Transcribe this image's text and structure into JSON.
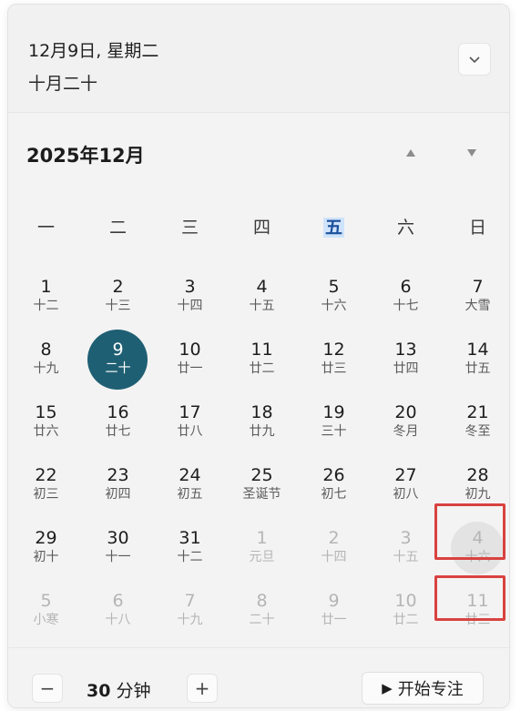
{
  "header": {
    "date_line": "12月9日, 星期二",
    "lunar_line": "十月二十",
    "collapse_icon": "chevron-down-icon"
  },
  "calendar": {
    "month_title": "2025年12月",
    "nav_up_icon": "triangle-up-icon",
    "nav_down_icon": "triangle-down-icon",
    "weekdays": [
      "一",
      "二",
      "三",
      "四",
      "五",
      "六",
      "日"
    ],
    "highlight_weekday_index": 4,
    "weeks": [
      [
        {
          "num": "1",
          "lunar": "十二"
        },
        {
          "num": "2",
          "lunar": "十三"
        },
        {
          "num": "3",
          "lunar": "十四"
        },
        {
          "num": "4",
          "lunar": "十五"
        },
        {
          "num": "5",
          "lunar": "十六"
        },
        {
          "num": "6",
          "lunar": "十七"
        },
        {
          "num": "7",
          "lunar": "大雪"
        }
      ],
      [
        {
          "num": "8",
          "lunar": "十九"
        },
        {
          "num": "9",
          "lunar": "二十",
          "selected": true
        },
        {
          "num": "10",
          "lunar": "廿一"
        },
        {
          "num": "11",
          "lunar": "廿二"
        },
        {
          "num": "12",
          "lunar": "廿三"
        },
        {
          "num": "13",
          "lunar": "廿四"
        },
        {
          "num": "14",
          "lunar": "廿五"
        }
      ],
      [
        {
          "num": "15",
          "lunar": "廿六"
        },
        {
          "num": "16",
          "lunar": "廿七"
        },
        {
          "num": "17",
          "lunar": "廿八"
        },
        {
          "num": "18",
          "lunar": "廿九"
        },
        {
          "num": "19",
          "lunar": "三十"
        },
        {
          "num": "20",
          "lunar": "冬月"
        },
        {
          "num": "21",
          "lunar": "冬至"
        }
      ],
      [
        {
          "num": "22",
          "lunar": "初三"
        },
        {
          "num": "23",
          "lunar": "初四"
        },
        {
          "num": "24",
          "lunar": "初五"
        },
        {
          "num": "25",
          "lunar": "圣诞节"
        },
        {
          "num": "26",
          "lunar": "初七"
        },
        {
          "num": "27",
          "lunar": "初八"
        },
        {
          "num": "28",
          "lunar": "初九"
        }
      ],
      [
        {
          "num": "29",
          "lunar": "初十"
        },
        {
          "num": "30",
          "lunar": "十一"
        },
        {
          "num": "31",
          "lunar": "十二"
        },
        {
          "num": "1",
          "lunar": "元旦",
          "other": true
        },
        {
          "num": "2",
          "lunar": "十四",
          "other": true
        },
        {
          "num": "3",
          "lunar": "十五",
          "other": true
        },
        {
          "num": "4",
          "lunar": "十六",
          "other": true,
          "hover": true,
          "boxed": true
        }
      ],
      [
        {
          "num": "5",
          "lunar": "小寒",
          "other": true
        },
        {
          "num": "6",
          "lunar": "十八",
          "other": true
        },
        {
          "num": "7",
          "lunar": "十九",
          "other": true
        },
        {
          "num": "8",
          "lunar": "二十",
          "other": true
        },
        {
          "num": "9",
          "lunar": "廿一",
          "other": true
        },
        {
          "num": "10",
          "lunar": "廿二",
          "other": true
        },
        {
          "num": "11",
          "lunar": "廿三",
          "other": true,
          "boxed": true
        }
      ]
    ]
  },
  "footer": {
    "minus_label": "−",
    "plus_label": "+",
    "minutes_value": "30",
    "minutes_unit": "分钟",
    "play_icon": "play-icon",
    "focus_label": "开始专注"
  },
  "colors": {
    "selected_fill": "#1f5f73",
    "annotation_red": "#d9423f",
    "today_column_bg": "#cfe3fb"
  }
}
